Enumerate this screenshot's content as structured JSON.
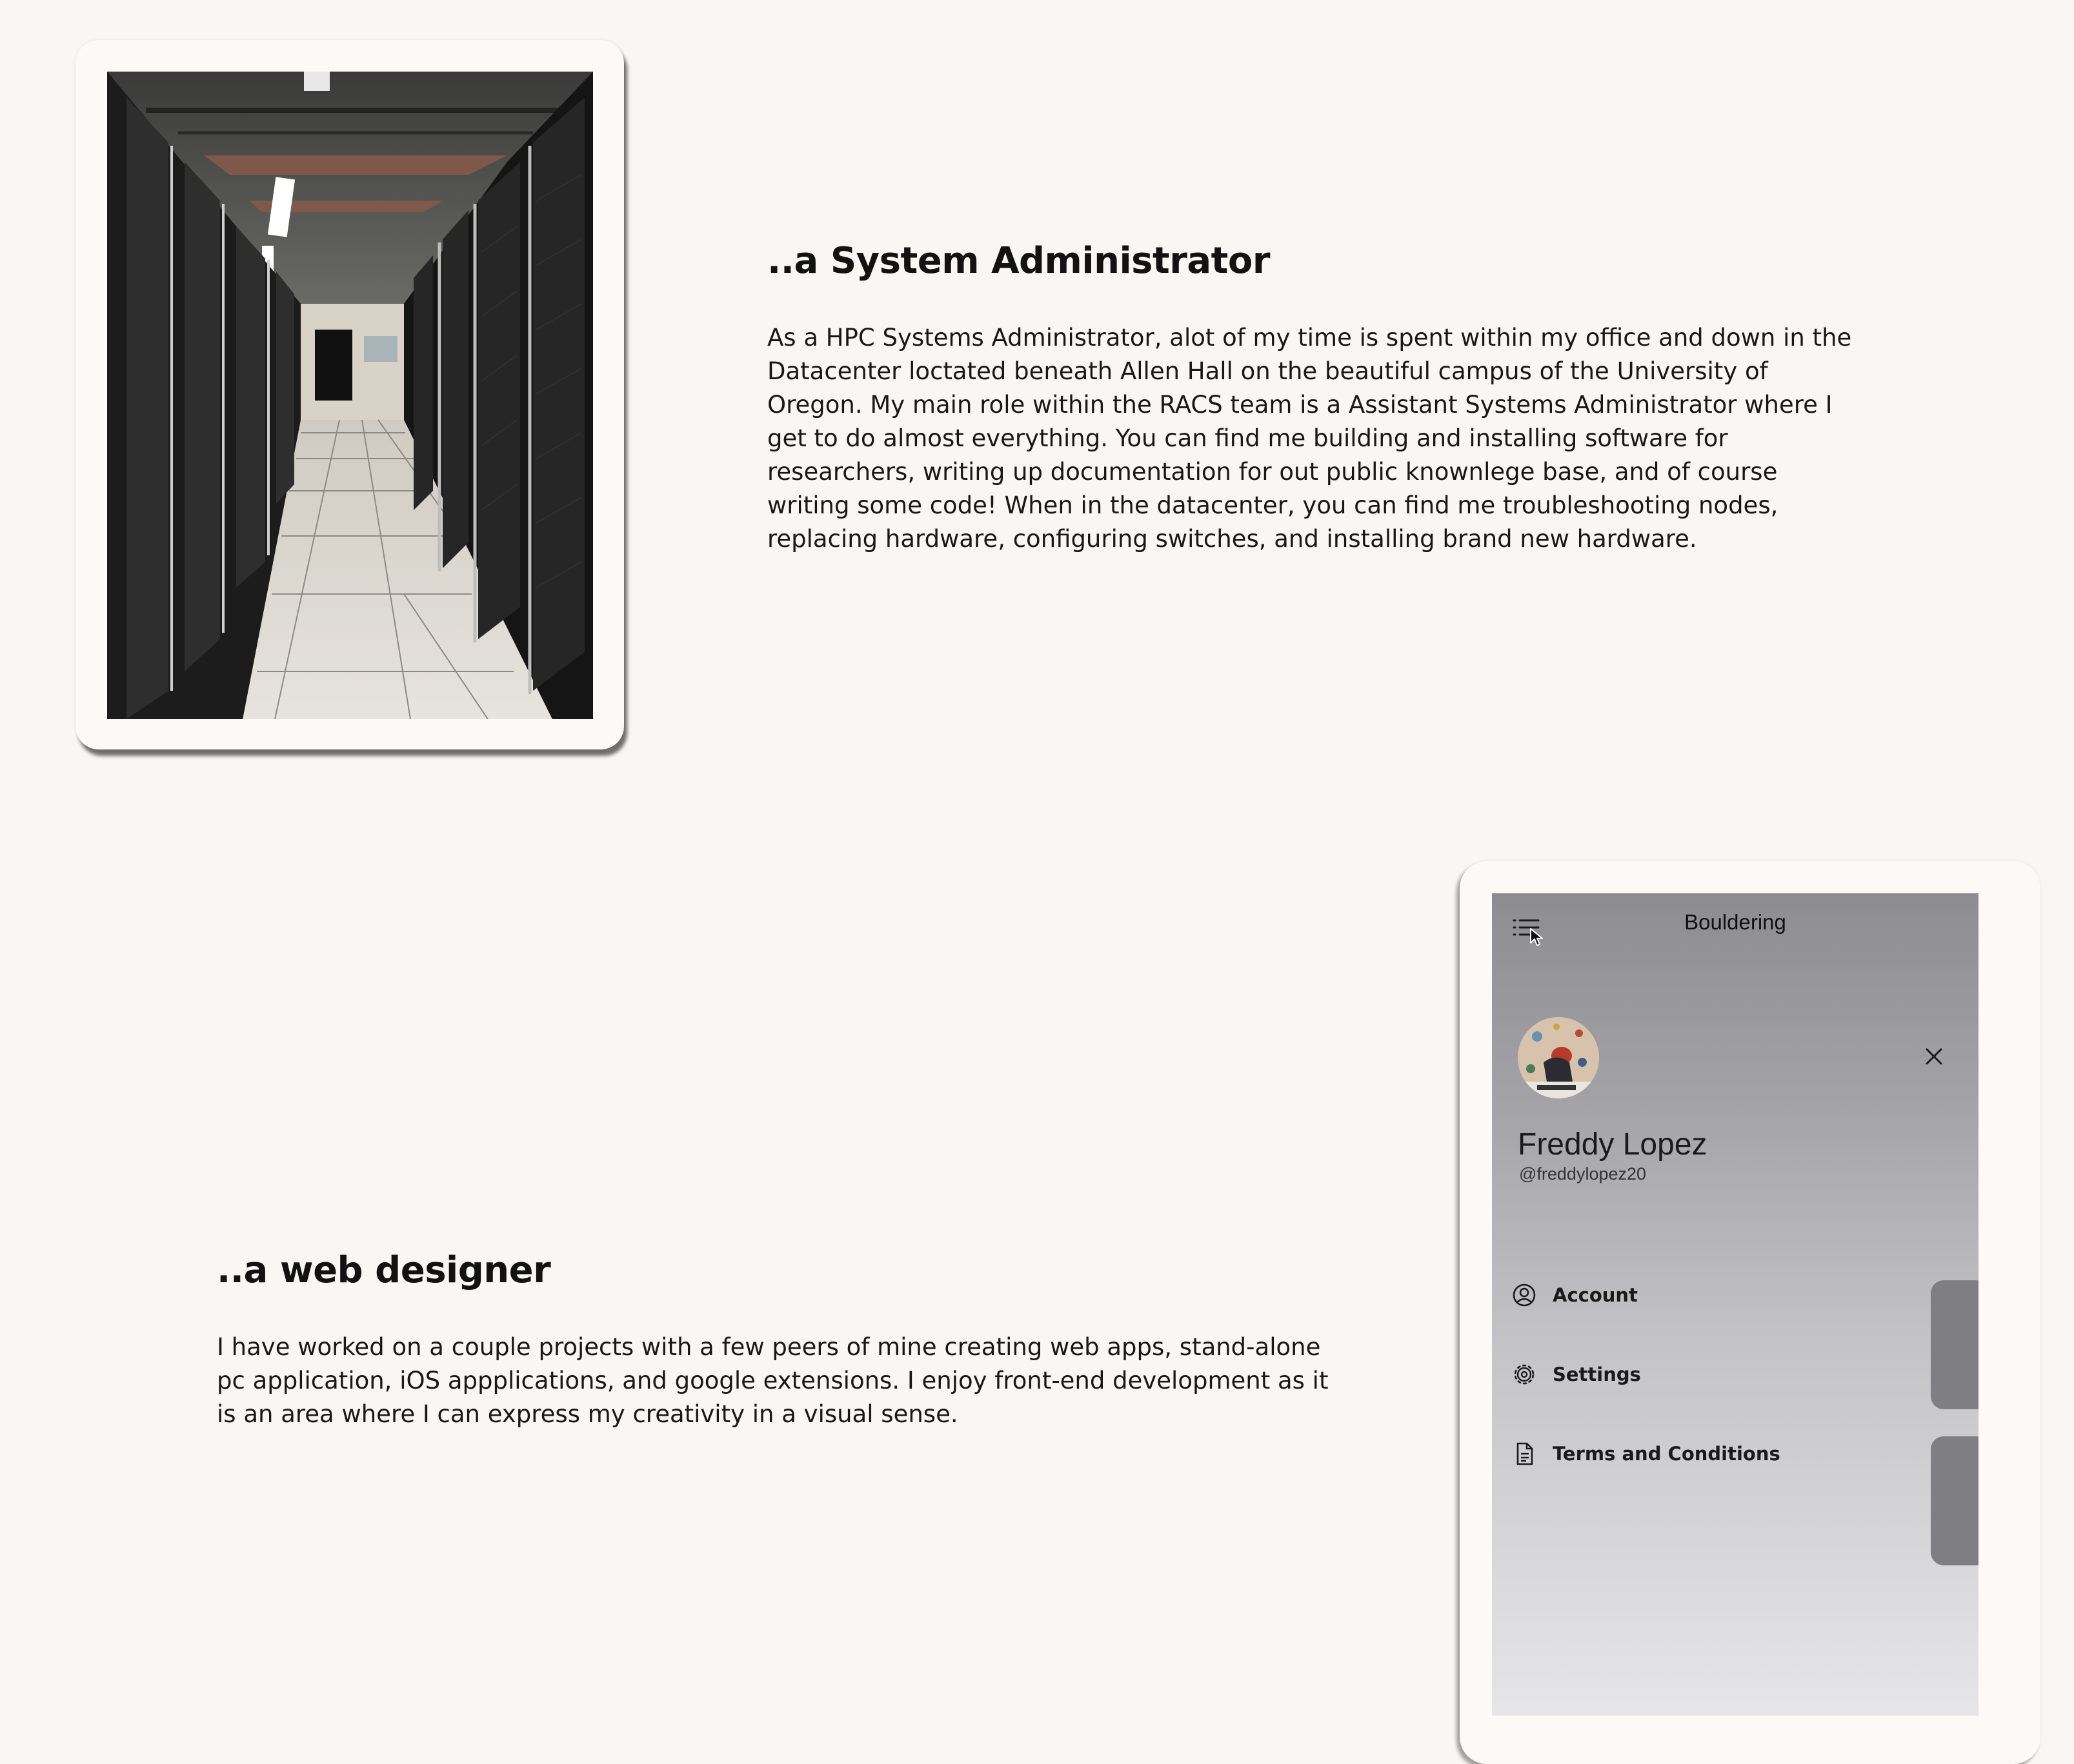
{
  "sections": {
    "sysadmin": {
      "heading": "..a System Administrator",
      "body": "As a HPC Systems Administrator, alot of my time is spent within my office and down in the Datacenter loctated beneath Allen Hall on the beautiful campus of the University of Oregon. My main role within the RACS team is a Assistant Systems Administrator where I get to do almost everything. You can find me building and installing software for researchers, writing up documentation for out public knownlege base, and of course writing some code! When in the datacenter, you can find me troubleshooting nodes, replacing hardware, configuring switches, and installing brand new hardware."
    },
    "webdesign": {
      "heading": "..a web designer",
      "body": "I have worked on a couple projects with a few peers of mine creating web apps, stand-alone pc application, iOS appplications, and google extensions. I enjoy front-end development as it is an area where I can express my creativity in a visual sense."
    }
  },
  "phone": {
    "app_title": "Bouldering",
    "menu_icon": "hamburger-list-icon",
    "close_icon": "close-icon",
    "profile": {
      "name": "Freddy Lopez",
      "handle": "@freddylopez20"
    },
    "menu": [
      {
        "label": "Account",
        "icon": "user-circle-icon"
      },
      {
        "label": "Settings",
        "icon": "gear-icon"
      },
      {
        "label": "Terms and Conditions",
        "icon": "document-icon"
      }
    ]
  },
  "colors": {
    "page_background": "#f8f7f4",
    "card_background": "#fbfaf7",
    "screen_gradient_top": "#8d8d91",
    "screen_gradient_bottom": "#e6e6e8",
    "side_tab": "#7f7f83"
  }
}
